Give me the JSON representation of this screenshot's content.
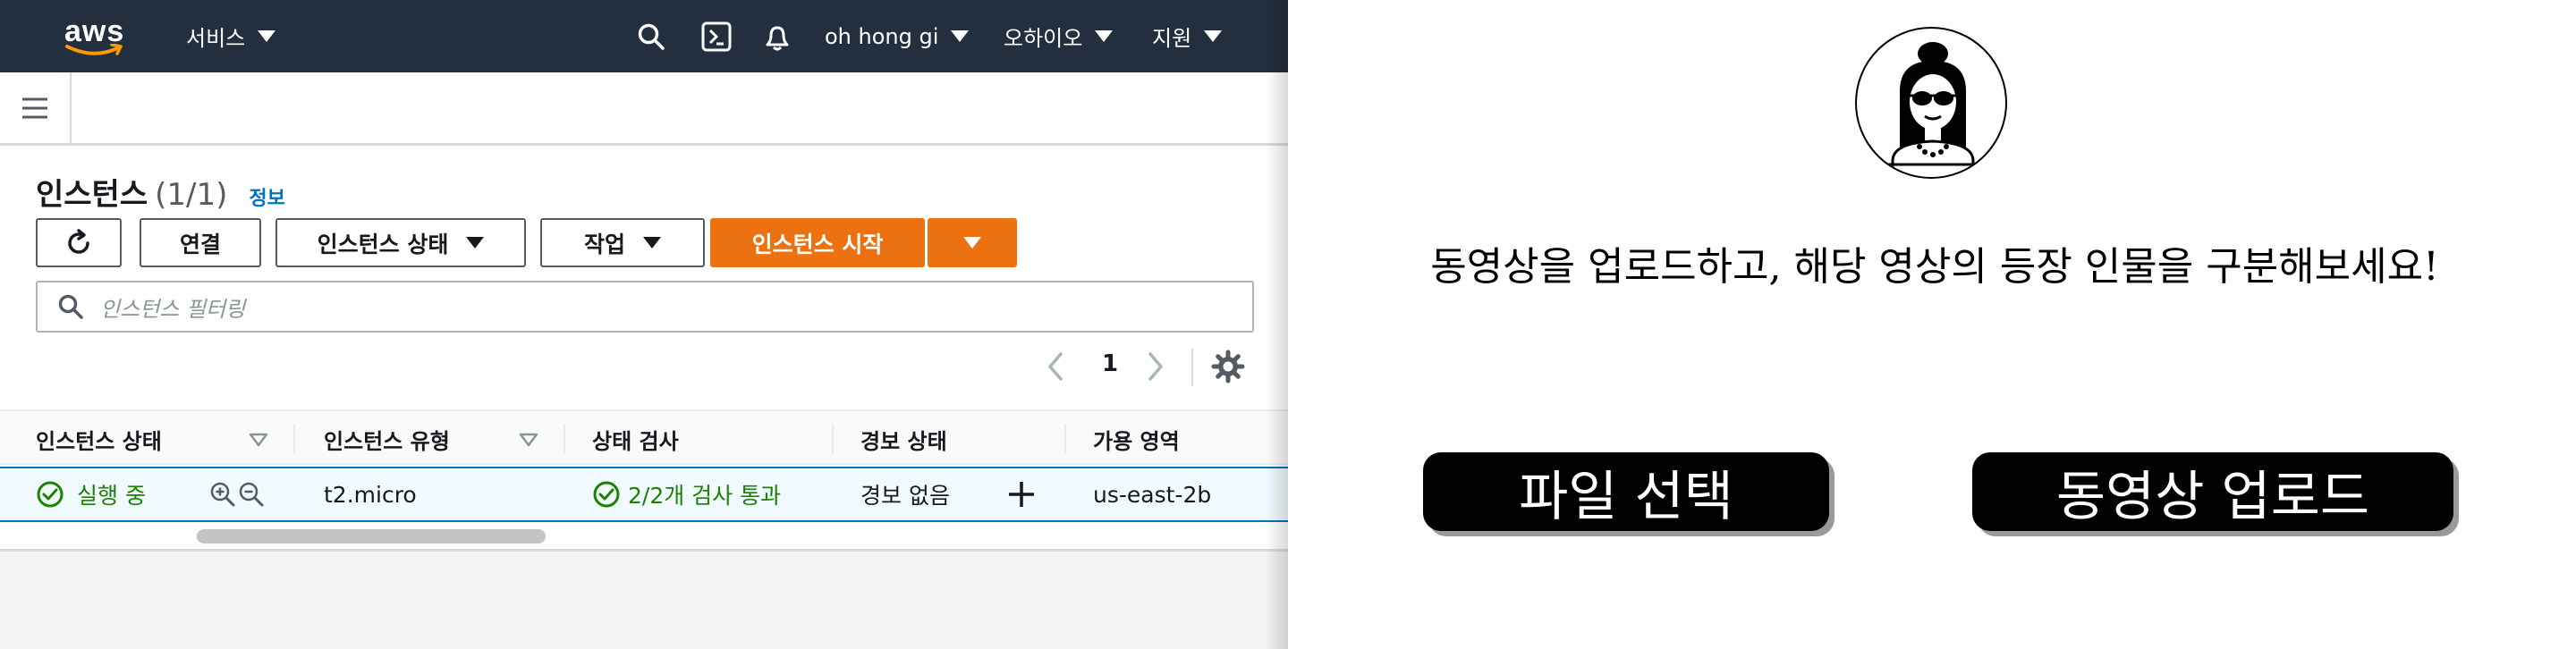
{
  "aws": {
    "topbar": {
      "logo_text": "aws",
      "services": "서비스",
      "user": "oh hong gi",
      "region": "오하이오",
      "support": "지원"
    },
    "instances": {
      "title": "인스턴스",
      "count": "(1/1)",
      "info": "정보",
      "buttons": {
        "connect": "연결",
        "instance_state": "인스턴스 상태",
        "actions": "작업",
        "launch": "인스턴스 시작"
      },
      "filter_placeholder": "인스턴스 필터링",
      "page": "1",
      "columns": [
        "인스턴스 상태",
        "인스턴스 유형",
        "상태 검사",
        "경보 상태",
        "가용 영역"
      ],
      "row": {
        "state": "실행 중",
        "type": "t2.micro",
        "check": "2/2개 검사 통과",
        "alarm": "경보 없음",
        "zone": "us-east-2b"
      }
    },
    "colors": {
      "topbar": "#232f3e",
      "primary": "#ec7211",
      "link": "#0073bb",
      "success": "#1d8102"
    }
  },
  "app": {
    "message": "동영상을 업로드하고, 해당 영상의 등장 인물을 구분해보세요!",
    "file_button": "파일 선택",
    "upload_button": "동영상 업로드"
  }
}
